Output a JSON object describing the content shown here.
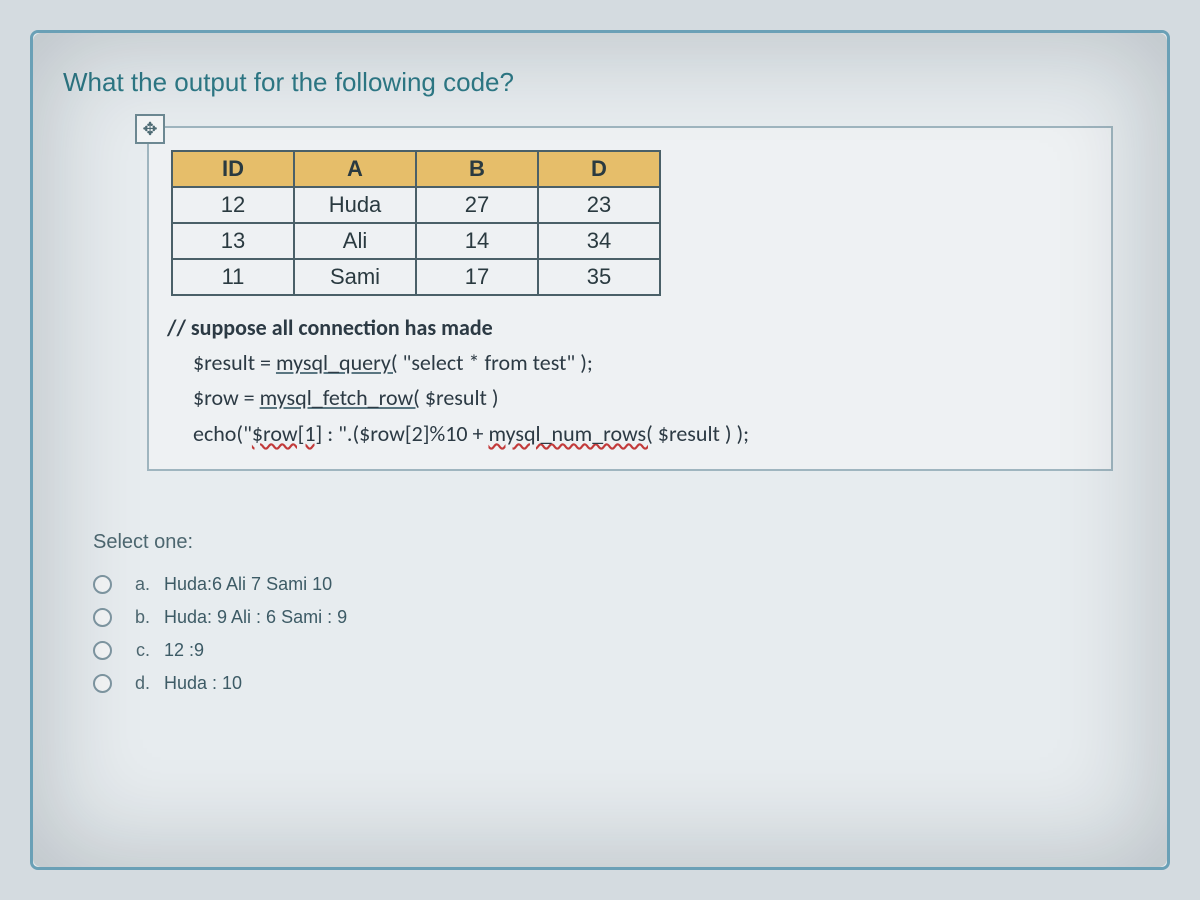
{
  "question": "What the output for the following code?",
  "table": {
    "headers": [
      "ID",
      "A",
      "B",
      "D"
    ],
    "rows": [
      [
        "12",
        "Huda",
        "27",
        "23"
      ],
      [
        "13",
        "Ali",
        "14",
        "34"
      ],
      [
        "11",
        "Sami",
        "17",
        "35"
      ]
    ]
  },
  "code": {
    "l1_a": "// suppose all connection has made",
    "l2_a": "$result = ",
    "l2_b": "mysql_query(",
    "l2_c": " \"select * from test\" );",
    "l3_a": "$row = ",
    "l3_b": "mysql_fetch_row(",
    "l3_c": " $result )",
    "l4_a": "echo(\"",
    "l4_b": "$row[1]",
    "l4_c": " : \".($row[2]%10 + ",
    "l4_d": "mysql_num_rows(",
    "l4_e": " $result ) );"
  },
  "select_label": "Select one:",
  "options": [
    {
      "key": "a.",
      "val": "Huda:6 Ali 7 Sami 10"
    },
    {
      "key": "b.",
      "val": "Huda: 9 Ali : 6 Sami : 9"
    },
    {
      "key": "c.",
      "val": "12 :9"
    },
    {
      "key": "d.",
      "val": "Huda : 10"
    }
  ],
  "handle_glyph": "✥"
}
